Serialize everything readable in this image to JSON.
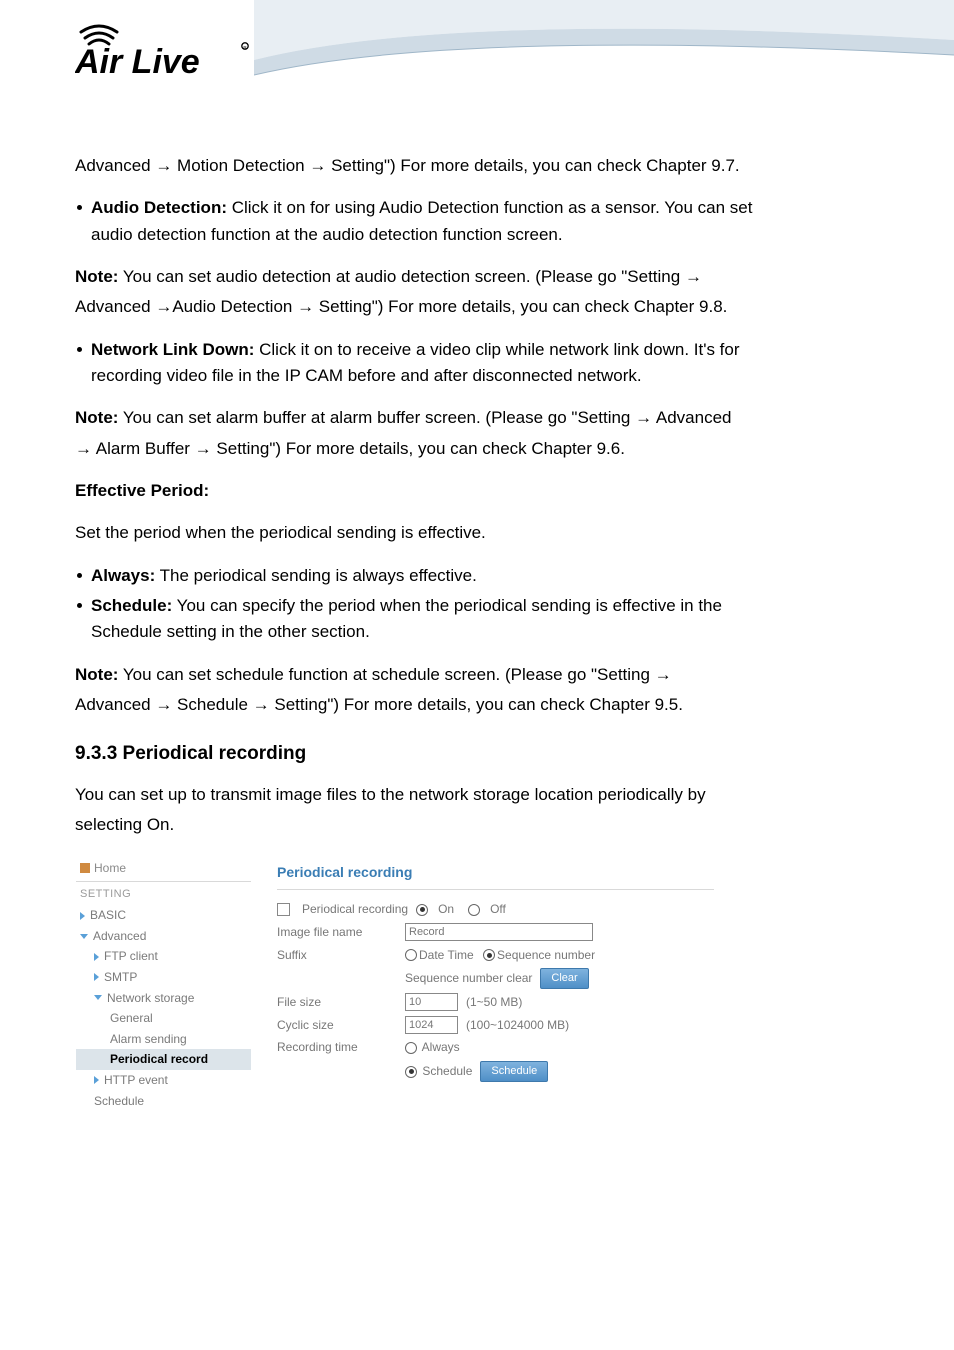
{
  "header": {
    "logo_alt": "Air Live"
  },
  "body": {
    "line1": "Advanced → Motion Detection → Setting\") For more details, you can check Chapter 9.7.",
    "bullet_audio_label": "Audio Detection:",
    "bullet_audio_rest": " Click it on for using Audio Detection function as a sensor. You can set",
    "bullet_audio_cont": "audio detection function at the audio detection function screen.",
    "note1_label": "Note:",
    "note1_l1": " You can set audio detection at audio detection screen. (Please go \"Setting →",
    "note1_l2": "Advanced →Audio Detection → Setting\")   For more details, you can check Chapter 9.8.",
    "bullet_net_label": "Network Link Down:",
    "bullet_net_rest": " Click it on to receive a video clip while network link down. It's for",
    "bullet_net_cont": "recording video file in the IP CAM before and after disconnected network.",
    "note2_label": "Note:",
    "note2_l1": " You can set alarm buffer at alarm buffer screen. (Please go \"Setting → Advanced",
    "note2_l2": "→ Alarm Buffer → Setting\")   For more details, you can check Chapter 9.6.",
    "eff_period_heading": "Effective Period:",
    "eff_period_desc": "Set the period when the periodical sending is effective.",
    "bullet_always_label": "Always:",
    "bullet_always_rest": " The periodical sending is always effective.",
    "bullet_sched_label": "Schedule:",
    "bullet_sched_rest": " You can specify the period when the periodical sending is effective in the",
    "bullet_sched_cont": "Schedule setting in the other section.",
    "note3_label": "Note:",
    "note3_l1": " You can set schedule function at schedule screen. (Please go \"Setting →",
    "note3_l2": "Advanced → Schedule → Setting\") For more details, you can check Chapter 9.5.",
    "section_heading": "9.3.3 Periodical recording",
    "section_p1": "You can set up to transmit image files to the network storage location periodically by",
    "section_p2": "selecting On."
  },
  "ui": {
    "nav": {
      "home": "Home",
      "setting": "SETTING",
      "basic": "BASIC",
      "advanced": "Advanced",
      "ftp": "FTP client",
      "smtp": "SMTP",
      "netstore": "Network storage",
      "general": "General",
      "alarm": "Alarm sending",
      "periodical": "Periodical record",
      "http": "HTTP event",
      "schedule": "Schedule"
    },
    "panel": {
      "title": "Periodical recording",
      "pr_label": "Periodical recording",
      "on": "On",
      "off": "Off",
      "image_file_name": "Image file name",
      "image_file_value": "Record",
      "suffix": "Suffix",
      "date_time": "Date Time",
      "seq_num": "Sequence number",
      "seq_clear": "Sequence number clear",
      "clear_btn": "Clear",
      "file_size": "File size",
      "file_size_val": "10",
      "file_size_unit": "(1~50 MB)",
      "cyclic": "Cyclic size",
      "cyclic_val": "1024",
      "cyclic_unit": "(100~1024000 MB)",
      "rec_time": "Recording time",
      "always": "Always",
      "schedule": "Schedule",
      "sched_btn": "Schedule"
    }
  }
}
